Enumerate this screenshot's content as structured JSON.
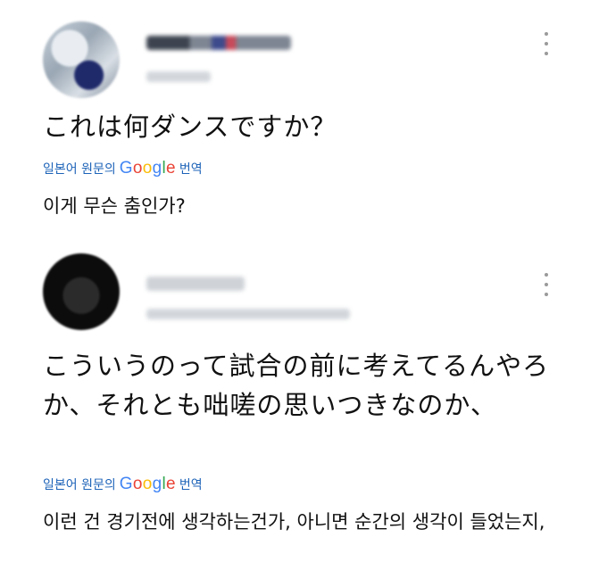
{
  "tweets": [
    {
      "text": "これは何ダンスですか？",
      "translate_prefix": "일본어 원문의",
      "translate_suffix": "번역",
      "translation": "이게 무슨 춤인가?"
    },
    {
      "text": "こういうのって試合の前に考えてるんやろか、それとも咄嗟の思いつきなのか、",
      "translate_prefix": "일본어 원문의",
      "translate_suffix": "번역",
      "translation": "이런 건 경기전에 생각하는건가, 아니면 순간의 생각이 들었는지,"
    }
  ],
  "google": {
    "G": "G",
    "o1": "o",
    "o2": "o",
    "g": "g",
    "l": "l",
    "e": "e"
  },
  "colors": {
    "translate_link": "#1d63b8",
    "text": "#111111",
    "more_icon": "#9a9a9a"
  },
  "icons": {
    "more": "more-vertical-icon"
  }
}
